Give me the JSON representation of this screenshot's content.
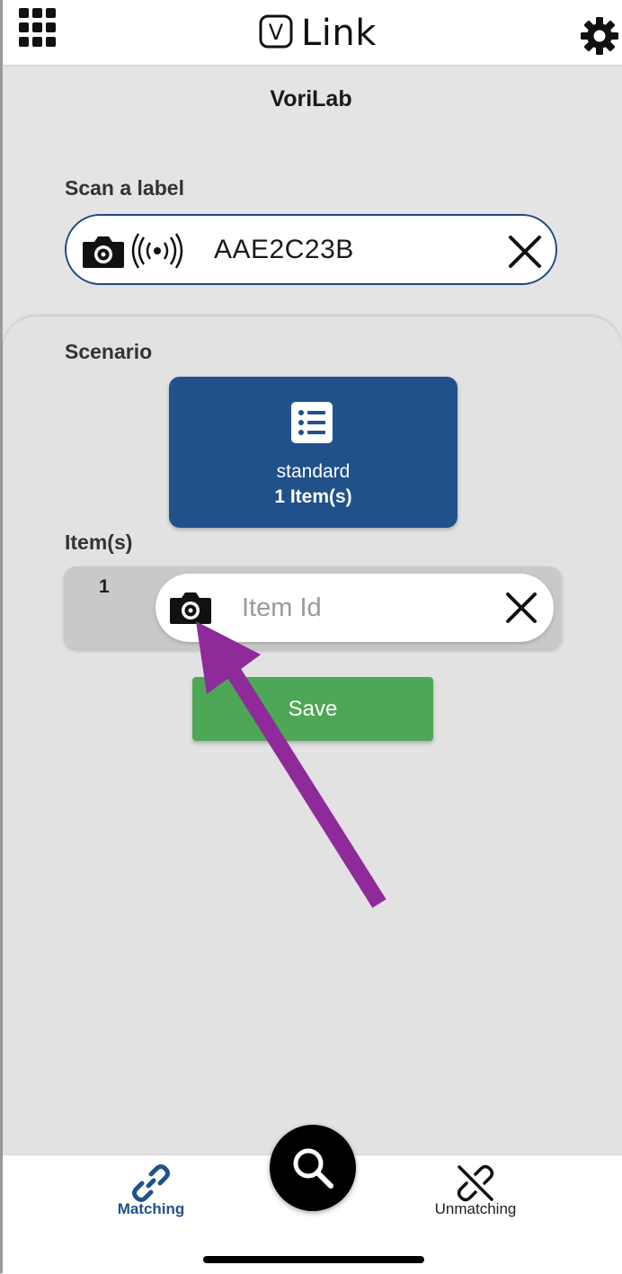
{
  "header": {
    "app_title": "Link",
    "logo_letter": "V",
    "menu_icon": "grid-icon",
    "settings_icon": "gear-icon"
  },
  "organization": "VoriLab",
  "scan": {
    "label": "Scan a label",
    "value": "AAE2C23B",
    "icons": [
      "camera-icon",
      "nfc-icon",
      "close-icon"
    ]
  },
  "scenario": {
    "label": "Scenario",
    "card": {
      "name": "standard",
      "count": "1 Item(s)",
      "icon": "list-icon"
    }
  },
  "items": {
    "label": "Item(s)",
    "rows": [
      {
        "index": "1",
        "placeholder": "Item Id"
      }
    ]
  },
  "actions": {
    "save_label": "Save"
  },
  "bottom_nav": {
    "matching_label": "Matching",
    "unmatching_label": "Unmatching",
    "active": "Matching",
    "fab_icon": "search-icon"
  },
  "colors": {
    "primary_blue": "#21518a",
    "save_green": "#4ea756",
    "annotation_purple": "#8e2a99",
    "background": "#e4e4e4"
  }
}
